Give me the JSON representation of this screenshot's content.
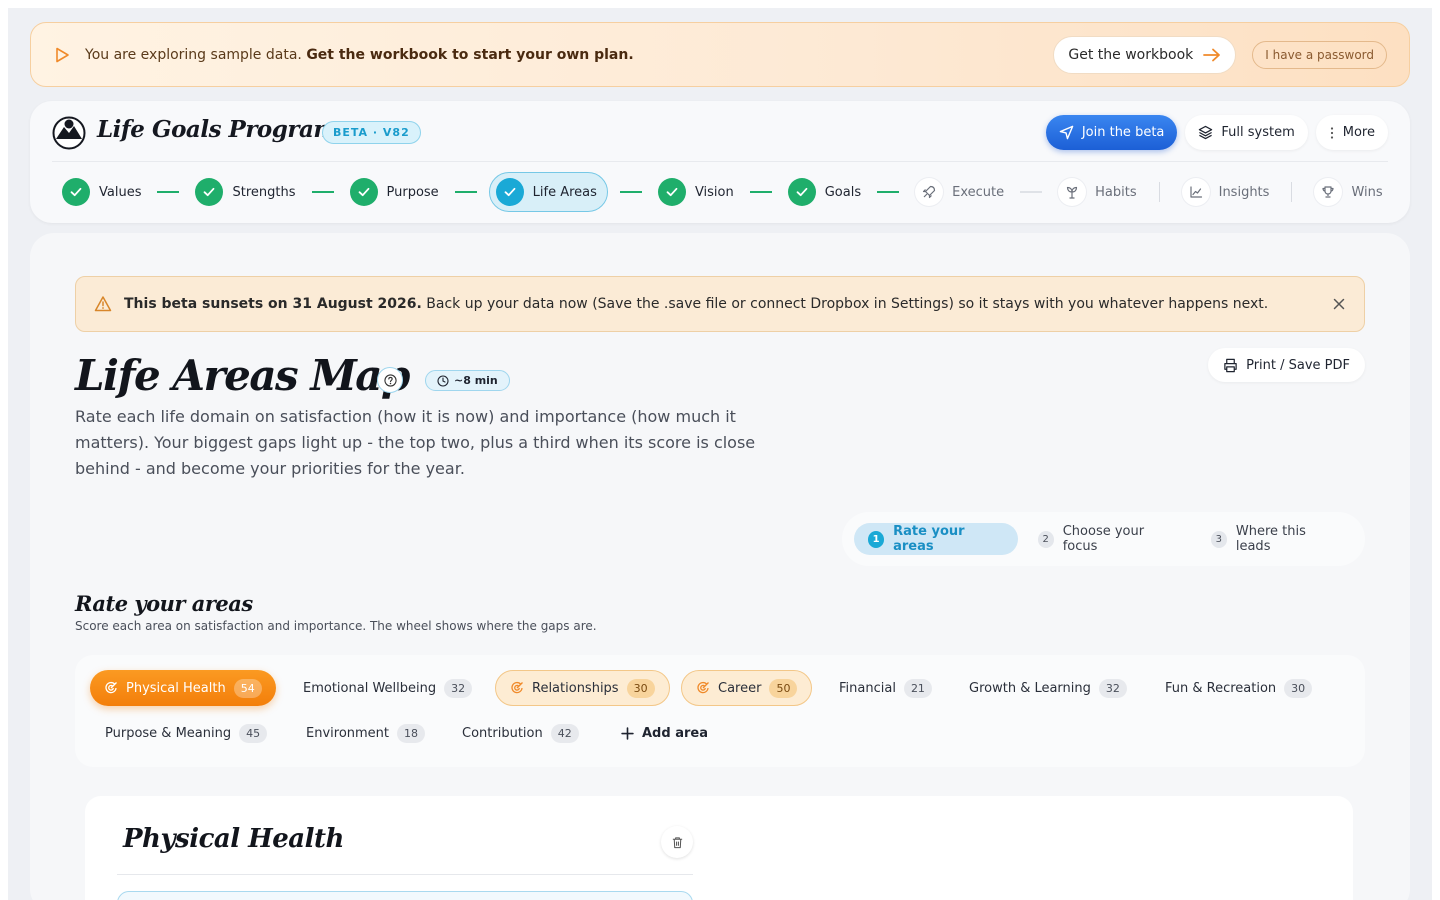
{
  "banner": {
    "text_lead": "You are exploring sample data.",
    "text_bold": "Get the workbook to start your own plan.",
    "workbook_label": "Get the workbook",
    "password_label": "I have a password"
  },
  "header": {
    "brand": "Life Goals Program",
    "beta_label": "BETA · V82",
    "join_label": "Join the beta",
    "full_system_label": "Full system",
    "more_label": "More"
  },
  "steps": [
    {
      "label": "Values",
      "state": "done"
    },
    {
      "label": "Strengths",
      "state": "done"
    },
    {
      "label": "Purpose",
      "state": "done"
    },
    {
      "label": "Life Areas",
      "state": "active"
    },
    {
      "label": "Vision",
      "state": "done"
    },
    {
      "label": "Goals",
      "state": "done"
    },
    {
      "label": "Execute",
      "state": "todo",
      "icon": "rocket-icon"
    },
    {
      "label": "Habits",
      "state": "todo",
      "icon": "sprout-icon"
    },
    {
      "label": "Insights",
      "state": "todo",
      "icon": "chart-icon"
    },
    {
      "label": "Wins",
      "state": "todo",
      "icon": "trophy-icon"
    }
  ],
  "notice": {
    "bold": "This beta sunsets on 31 August 2026.",
    "text": "Back up your data now (Save the .save file or connect Dropbox in Settings) so it stays with you whatever happens next."
  },
  "page": {
    "title": "Life Areas Map",
    "time": "~8 min",
    "print_label": "Print / Save PDF",
    "description": "Rate each life domain on satisfaction (how it is now) and importance (how much it matters). Your biggest gaps light up - the top two, plus a third when its score is close behind - and become your priorities for the year."
  },
  "tabs": [
    {
      "num": "1",
      "label": "Rate your areas"
    },
    {
      "num": "2",
      "label": "Choose your focus"
    },
    {
      "num": "3",
      "label": "Where this leads"
    }
  ],
  "section": {
    "title": "Rate your areas",
    "subtitle": "Score each area on satisfaction and importance. The wheel shows where the gaps are."
  },
  "areas": [
    {
      "label": "Physical Health",
      "score": "54",
      "state": "selected"
    },
    {
      "label": "Emotional Wellbeing",
      "score": "32",
      "state": "normal"
    },
    {
      "label": "Relationships",
      "score": "30",
      "state": "focus"
    },
    {
      "label": "Career",
      "score": "50",
      "state": "focus"
    },
    {
      "label": "Financial",
      "score": "21",
      "state": "normal"
    },
    {
      "label": "Growth & Learning",
      "score": "32",
      "state": "normal"
    },
    {
      "label": "Fun & Recreation",
      "score": "30",
      "state": "normal"
    },
    {
      "label": "Purpose & Meaning",
      "score": "45",
      "state": "normal"
    },
    {
      "label": "Environment",
      "score": "18",
      "state": "normal"
    },
    {
      "label": "Contribution",
      "score": "42",
      "state": "normal"
    }
  ],
  "add_area_label": "Add area",
  "detail": {
    "title": "Physical Health"
  },
  "colors": {
    "accent_blue": "#1aa9d6",
    "done_green": "#1fae6b",
    "orange": "#f37e0a"
  }
}
